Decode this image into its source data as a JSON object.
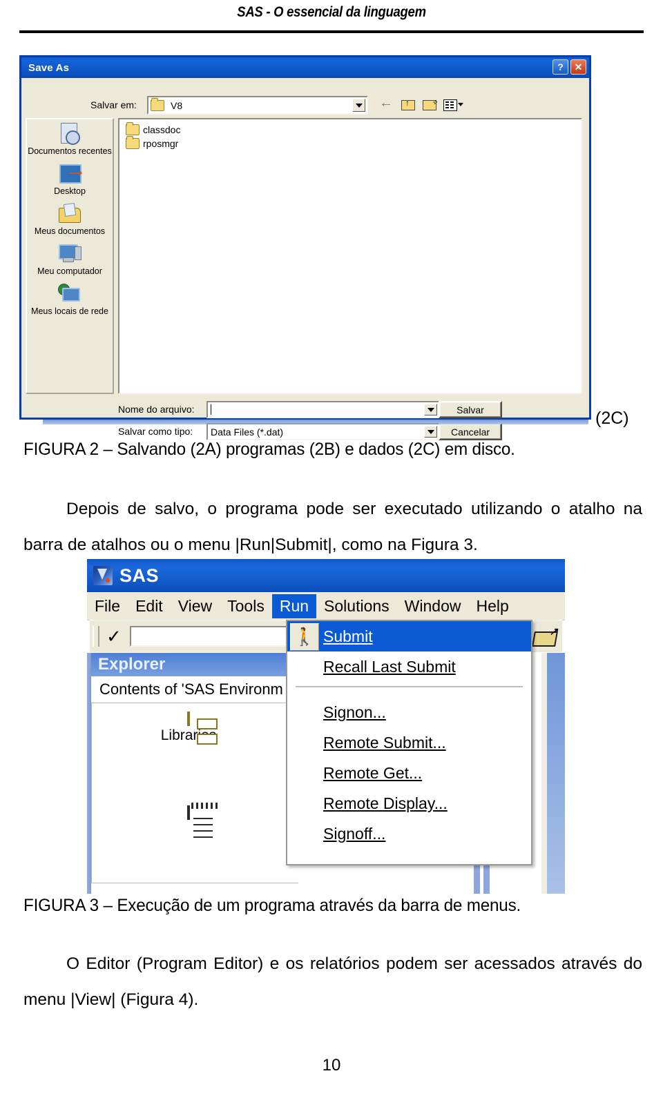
{
  "document": {
    "header_title": "SAS - O essencial da linguagem",
    "page_number": "10"
  },
  "figure2": {
    "label_2c": "(2C)",
    "caption": "FIGURA 2 – Salvando (2A) programas (2B) e dados (2C) em disco.",
    "dialog": {
      "title": "Save As",
      "help_button": "?",
      "close_button": "✕",
      "lookin_label": "Salvar em:",
      "lookin_value": "V8",
      "toolbar_icons": [
        "back-icon",
        "up-one-level-icon",
        "new-folder-icon",
        "views-icon"
      ],
      "places": [
        {
          "label": "Documentos recentes",
          "icon": "recent-documents-icon"
        },
        {
          "label": "Desktop",
          "icon": "desktop-icon"
        },
        {
          "label": "Meus documentos",
          "icon": "my-documents-icon"
        },
        {
          "label": "Meu computador",
          "icon": "my-computer-icon"
        },
        {
          "label": "Meus locais de rede",
          "icon": "network-places-icon"
        }
      ],
      "files": [
        {
          "name": "classdoc",
          "icon": "folder-icon"
        },
        {
          "name": "rposmgr",
          "icon": "folder-icon"
        }
      ],
      "filename_label": "Nome do arquivo:",
      "filename_value": "",
      "filetype_label": "Salvar como tipo:",
      "filetype_value": "Data Files (*.dat)",
      "save_button": "Salvar",
      "cancel_button": "Cancelar"
    }
  },
  "paragraph1": {
    "text": "Depois de salvo, o programa pode ser executado utilizando o atalho na barra de atalhos ou o menu |Run|Submit|, como na Figura 3."
  },
  "figure3": {
    "caption": "FIGURA 3 – Execução de um programa através da barra de menus.",
    "window": {
      "title": "SAS",
      "menus": [
        {
          "label": "File",
          "active": false
        },
        {
          "label": "Edit",
          "active": false
        },
        {
          "label": "View",
          "active": false
        },
        {
          "label": "Tools",
          "active": false
        },
        {
          "label": "Run",
          "active": true
        },
        {
          "label": "Solutions",
          "active": false
        },
        {
          "label": "Window",
          "active": false
        },
        {
          "label": "Help",
          "active": false
        }
      ],
      "toolbar": {
        "check_icon": "✓",
        "command_value": "",
        "open_icon": "open-folder-icon"
      },
      "explorer": {
        "title": "Explorer",
        "contents_label": "Contents of 'SAS Environm",
        "items": [
          {
            "label": "Libraries",
            "icon": "file-cabinet-icon"
          },
          {
            "label": "",
            "icon": "notepad-icon"
          }
        ]
      },
      "run_menu": [
        {
          "label": "Submit",
          "selected": true,
          "icon": "runner-icon"
        },
        {
          "label": "Recall Last Submit",
          "selected": false,
          "icon": ""
        },
        {
          "label": "Signon...",
          "selected": false,
          "icon": ""
        },
        {
          "label": "Remote Submit...",
          "selected": false,
          "icon": ""
        },
        {
          "label": "Remote Get...",
          "selected": false,
          "icon": ""
        },
        {
          "label": "Remote Display...",
          "selected": false,
          "icon": ""
        },
        {
          "label": "Signoff...",
          "selected": false,
          "icon": ""
        }
      ]
    }
  },
  "paragraph2": {
    "text": "O Editor (Program Editor) e os relatórios podem ser acessados através do menu |View| (Figura 4)."
  }
}
